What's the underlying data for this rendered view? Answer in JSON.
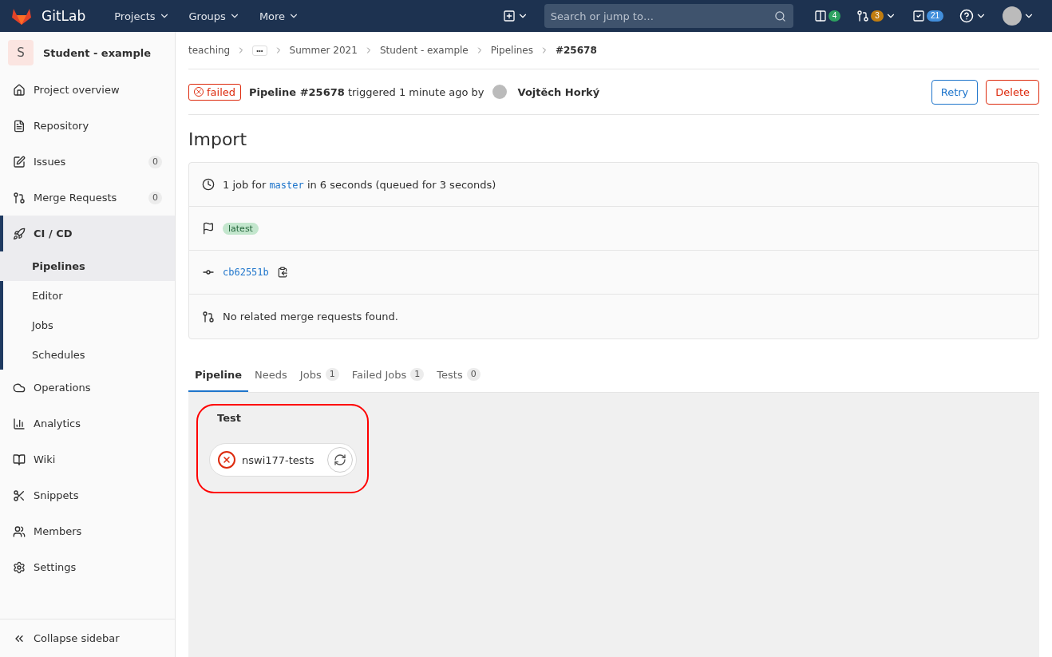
{
  "navbar": {
    "logo_text": "GitLab",
    "menus": [
      {
        "label": "Projects"
      },
      {
        "label": "Groups"
      },
      {
        "label": "More"
      }
    ],
    "search": {
      "placeholder": "Search or jump to…"
    },
    "counters": [
      {
        "count": "4",
        "color": "#2da160"
      },
      {
        "count": "3",
        "color": "#c17d10"
      },
      {
        "count": "21",
        "color": "#428fdc"
      }
    ]
  },
  "sidebar": {
    "project": {
      "avatar": "S",
      "name": "Student - example"
    },
    "items": [
      {
        "label": "Project overview",
        "expanded": false
      },
      {
        "label": "Repository",
        "expanded": false
      },
      {
        "label": "Issues",
        "count": "0",
        "expanded": false
      },
      {
        "label": "Merge Requests",
        "count": "0",
        "expanded": false
      },
      {
        "label": "CI / CD",
        "expanded": true,
        "children": [
          {
            "label": "Pipelines",
            "selected": true
          },
          {
            "label": "Editor",
            "selected": false
          },
          {
            "label": "Jobs",
            "selected": false
          },
          {
            "label": "Schedules",
            "selected": false
          }
        ]
      },
      {
        "label": "Operations",
        "expanded": false
      },
      {
        "label": "Analytics",
        "expanded": false
      },
      {
        "label": "Wiki",
        "expanded": false
      },
      {
        "label": "Snippets",
        "expanded": false
      },
      {
        "label": "Members",
        "expanded": false
      },
      {
        "label": "Settings",
        "expanded": false
      }
    ],
    "collapse": "Collapse sidebar"
  },
  "breadcrumbs": [
    {
      "label": "teaching",
      "kind": "link"
    },
    {
      "label": "•••",
      "kind": "more"
    },
    {
      "label": "Summer 2021",
      "kind": "link"
    },
    {
      "label": "Student - example",
      "kind": "link"
    },
    {
      "label": "Pipelines",
      "kind": "link"
    },
    {
      "label": "#25678",
      "kind": "current"
    }
  ],
  "pipeline_header": {
    "status": "failed",
    "title": "Pipeline #25678",
    "text": "triggered 1 minute ago by",
    "user": "Vojtěch Horký",
    "buttons": [
      {
        "label": "Retry",
        "kind": "primary"
      },
      {
        "label": "Delete",
        "kind": "danger"
      }
    ]
  },
  "title": "Import",
  "info": {
    "jobs_prefix": "1 job for",
    "branch": "master",
    "jobs_suffix": "in 6 seconds (queued for 3 seconds)",
    "badge": "latest",
    "commit": "cb62551b",
    "merge_requests": "No related merge requests found."
  },
  "tabs": [
    {
      "label": "Pipeline",
      "selected": true
    },
    {
      "label": "Needs",
      "selected": false
    },
    {
      "label": "Jobs",
      "count": "1",
      "selected": false
    },
    {
      "label": "Failed Jobs",
      "count": "1",
      "selected": false
    },
    {
      "label": "Tests",
      "count": "0",
      "selected": false
    }
  ],
  "graph": {
    "stages": [
      {
        "name": "Test",
        "highlighted": true,
        "jobs": [
          {
            "name": "nswi177-tests",
            "failed": true
          }
        ]
      }
    ]
  }
}
